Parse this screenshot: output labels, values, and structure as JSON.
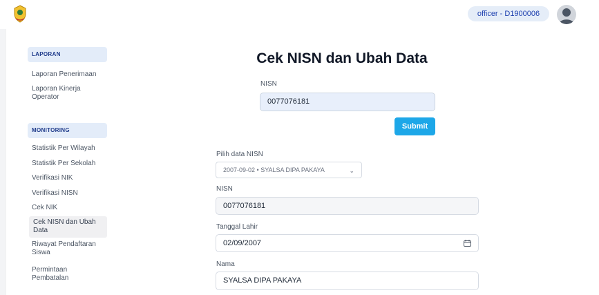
{
  "header": {
    "user_badge": "officer - D1900006",
    "logo_icon": "emblem-logo-icon",
    "avatar_icon": "user-avatar-icon"
  },
  "sidebar": {
    "sections": [
      {
        "title": "LAPORAN",
        "items": [
          "Laporan Penerimaan",
          "Laporan Kinerja Operator"
        ]
      },
      {
        "title": "MONITORING",
        "items": [
          "Statistik Per Wilayah",
          "Statistik Per Sekolah",
          "Verifikasi NIK",
          "Verifikasi NISN",
          "Cek NIK",
          "Cek NISN dan Ubah Data",
          "Riwayat Pendaftaran Siswa",
          "Permintaan Pembatalan"
        ]
      }
    ],
    "active_item": "Cek NISN dan Ubah Data"
  },
  "main": {
    "title": "Cek NISN dan Ubah Data",
    "search": {
      "label": "NISN",
      "value": "0077076181",
      "submit_label": "Submit"
    },
    "form": {
      "select_label": "Pilih data NISN",
      "select_value": "2007-09-02 • SYALSA DIPA PAKAYA",
      "nisn_label": "NISN",
      "nisn_value": "0077076181",
      "dob_label": "Tanggal Lahir",
      "dob_value": "02/09/2007",
      "name_label": "Nama",
      "name_value": "SYALSA DIPA PAKAYA"
    }
  },
  "colors": {
    "accent": "#1da7e8",
    "section_bg": "#e3ecf9",
    "badge_bg": "#e5edf8"
  }
}
